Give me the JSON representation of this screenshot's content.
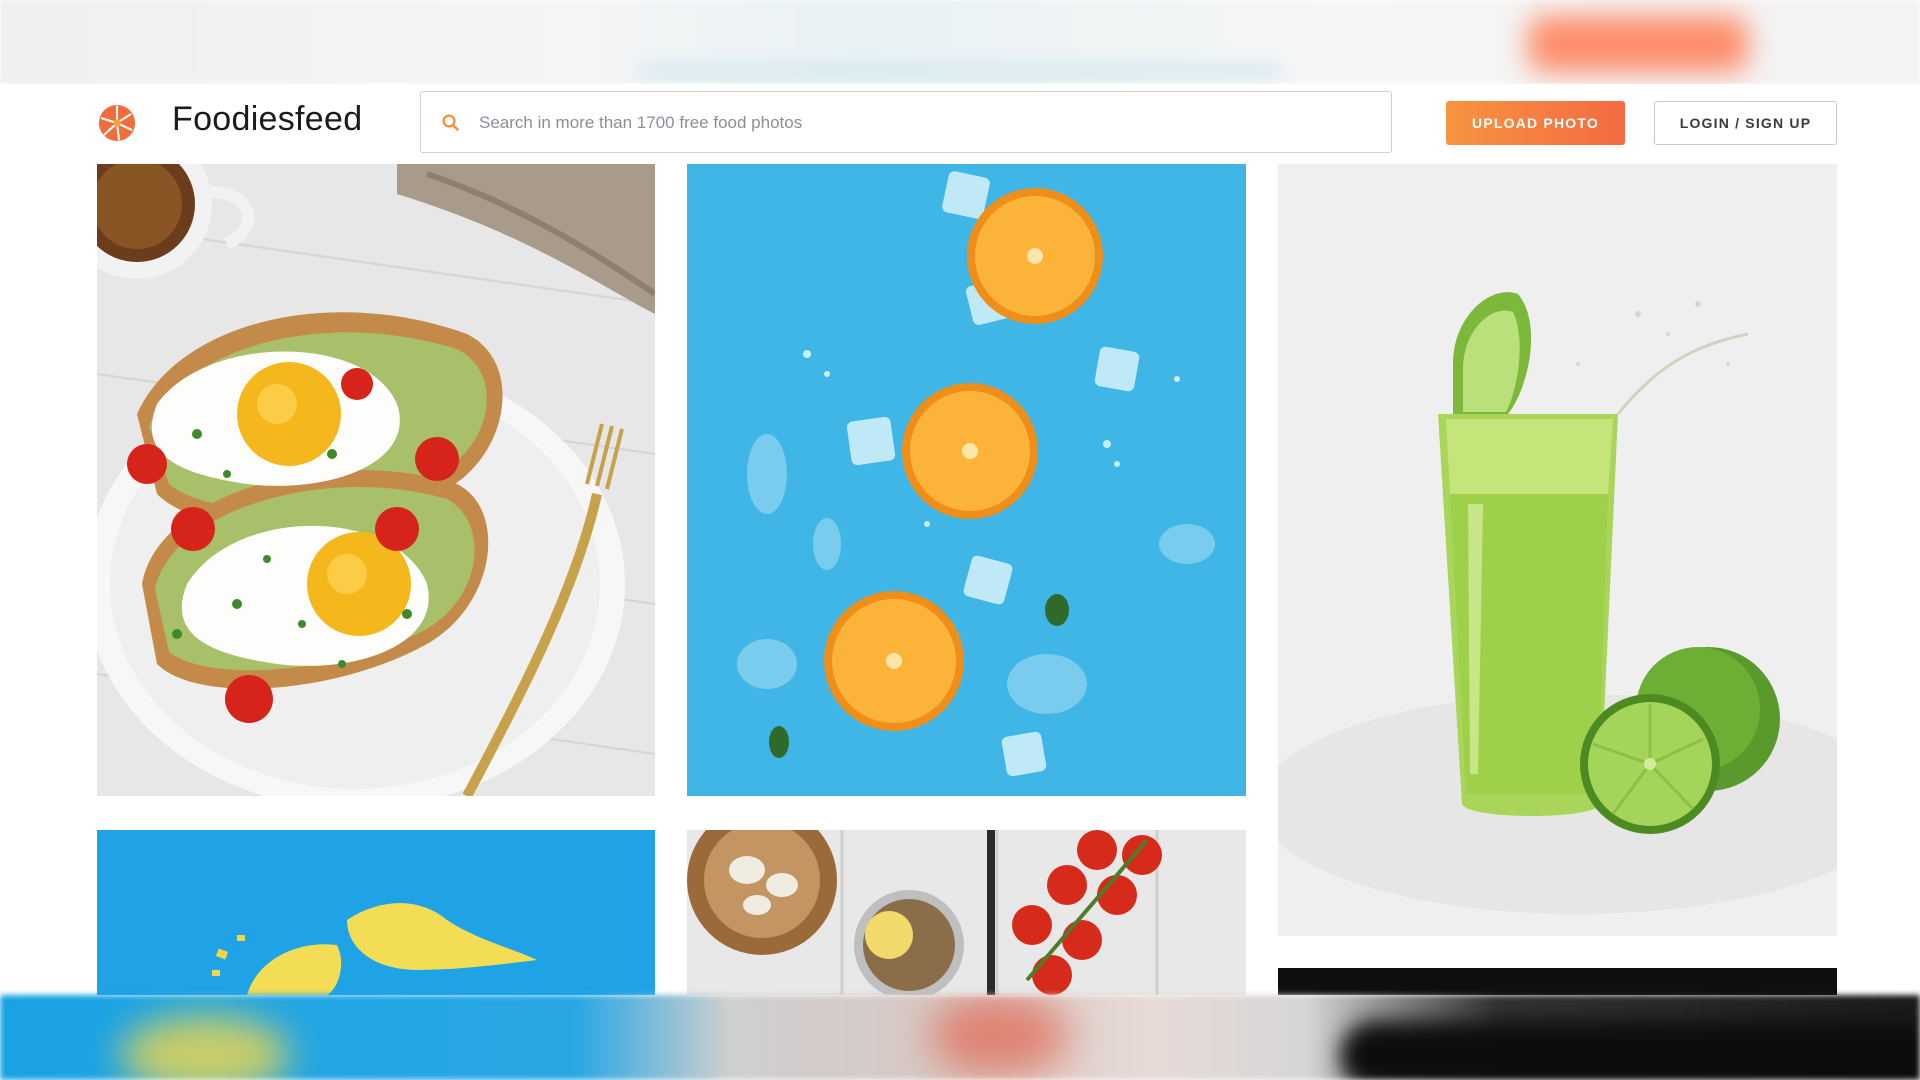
{
  "brand": {
    "name": "Foodiesfeed"
  },
  "search": {
    "placeholder": "Search in more than 1700 free food photos",
    "value": ""
  },
  "actions": {
    "upload_label": "UPLOAD PHOTO",
    "login_label": "LOGIN / SIGN UP"
  },
  "colors": {
    "accent_start": "#f7943f",
    "accent_end": "#f36a43",
    "search_icon": "#f58f3a"
  },
  "gallery": {
    "items": [
      {
        "subject": "avocado toast with fried eggs"
      },
      {
        "subject": "orange slices on blue"
      },
      {
        "subject": "lime juice"
      },
      {
        "subject": "banana on blue"
      },
      {
        "subject": "garlic, spices and tomatoes"
      },
      {
        "subject": "dark photo"
      }
    ]
  }
}
